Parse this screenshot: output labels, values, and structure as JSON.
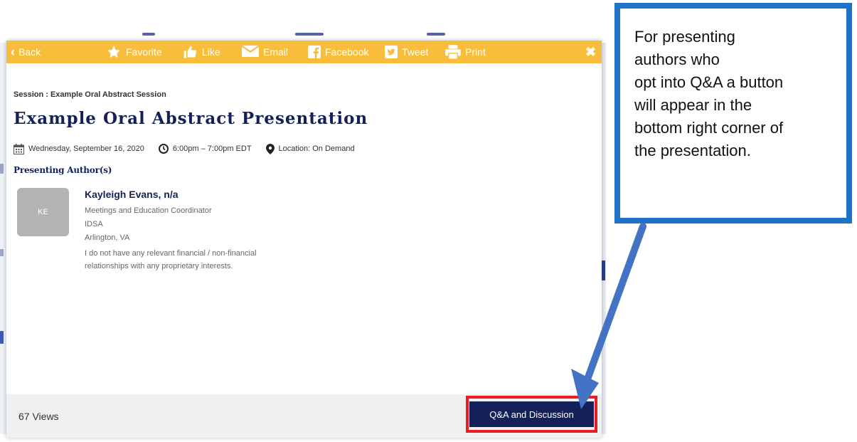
{
  "toolbar": {
    "back": "Back",
    "favorite": "Favorite",
    "like": "Like",
    "email": "Email",
    "facebook": "Facebook",
    "tweet": "Tweet",
    "print": "Print",
    "close": "✖"
  },
  "session": {
    "label": "Session : Example Oral Abstract Session",
    "title": "Example Oral Abstract Presentation",
    "date": "Wednesday, September 16, 2020",
    "time": "6:00pm – 7:00pm EDT",
    "location": "Location: On Demand"
  },
  "author": {
    "heading": "Presenting Author(s)",
    "initials": "KE",
    "name": "Kayleigh Evans, n/a",
    "role": "Meetings and Education Coordinator",
    "org": "IDSA",
    "city": "Arlington, VA",
    "disclosure_1": "I do not have any relevant financial / non-financial",
    "disclosure_2": "relationships with any proprietary interests."
  },
  "footer": {
    "views": "67 Views",
    "qa_button": "Q&A and Discussion"
  },
  "callout": {
    "line1": "For presenting",
    "line2": "authors who",
    "line3": "opt into Q&A a button",
    "line4": "will appear in the",
    "line5": "bottom right corner of",
    "line6": "the presentation."
  },
  "colors": {
    "toolbar": "#f8bd3b",
    "navy": "#14205a",
    "highlight": "#ec1c24",
    "callout_border": "#1e73c8"
  }
}
